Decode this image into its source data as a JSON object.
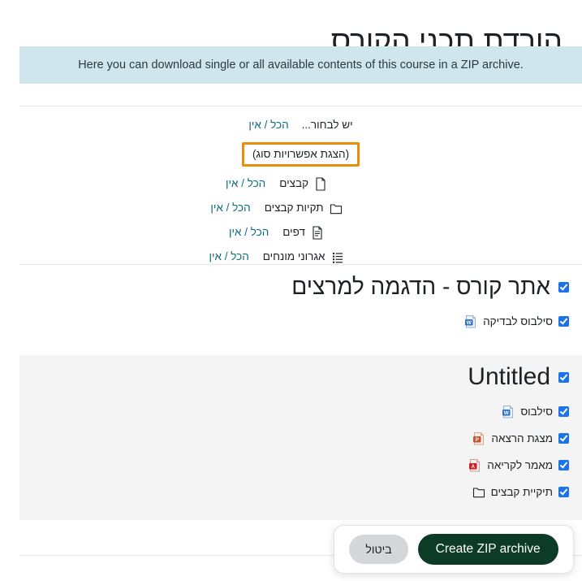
{
  "header": {
    "title": "הורדת תכני הקורס"
  },
  "banner": {
    "text": ".Here you can download single or all available contents of this course in a ZIP archive",
    "bg_color": "#cfe7ec"
  },
  "selector": {
    "select_label": "יש לבחור...",
    "all_none_label": "הכל / אין",
    "type_options_toggle": "(הצגת אפשרויות סוג)",
    "toggle_focus_color": "#e8900c",
    "types": [
      {
        "icon": "file-icon",
        "label": "קבצים",
        "all_none": "הכל / אין"
      },
      {
        "icon": "folder-icon",
        "label": "תקיות קבצים",
        "all_none": "הכל / אין"
      },
      {
        "icon": "page-icon",
        "label": "דפים",
        "all_none": "הכל / אין"
      },
      {
        "icon": "glossary-icon",
        "label": "אגרוני מונחים",
        "all_none": "הכל / אין"
      }
    ]
  },
  "sections": [
    {
      "title": "אתר קורס - הדגמה למרצים",
      "checked": true,
      "items": [
        {
          "label": "סילבוס לבדיקה",
          "icon": "word-doc-icon",
          "checked": true
        }
      ]
    },
    {
      "title": "Untitled",
      "checked": true,
      "items": [
        {
          "label": "סילבוס",
          "icon": "word-doc-icon",
          "checked": true
        },
        {
          "label": "מצגת הרצאה",
          "icon": "powerpoint-doc-icon",
          "checked": true
        },
        {
          "label": "מאמר לקריאה",
          "icon": "pdf-doc-icon",
          "checked": true
        },
        {
          "label": "תיקיית קבצים",
          "icon": "folder-icon",
          "checked": true
        }
      ]
    }
  ],
  "footer": {
    "create_label": "Create ZIP archive",
    "cancel_label": "ביטול",
    "create_color": "#0c3b27",
    "cancel_color": "#d4d7da"
  },
  "checkbox_color": "#1a73e8"
}
